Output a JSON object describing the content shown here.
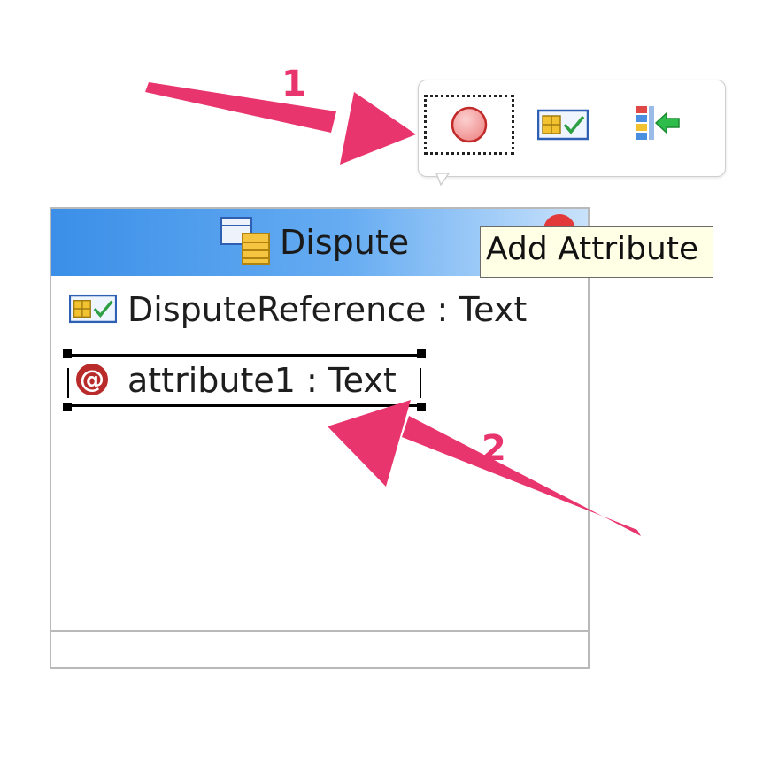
{
  "toolbar": {
    "tools": [
      {
        "name": "attribute-circle",
        "selected": true
      },
      {
        "name": "attribute-type"
      },
      {
        "name": "add-from-class"
      }
    ]
  },
  "tooltip": {
    "text": "Add Attribute"
  },
  "class_box": {
    "title": "Dispute",
    "attributes": [
      {
        "label": "DisputeReference : Text",
        "icon": "typed-attribute-icon"
      },
      {
        "label": "attribute1 : Text",
        "icon": "at-sign-icon",
        "icon_glyph": "@",
        "selected": true
      }
    ]
  },
  "annotations": {
    "step1": "1",
    "step2": "2"
  },
  "colors": {
    "accent": "#e8356d",
    "header_start": "#3b8fe8",
    "tooltip_bg": "#ffffe6"
  }
}
